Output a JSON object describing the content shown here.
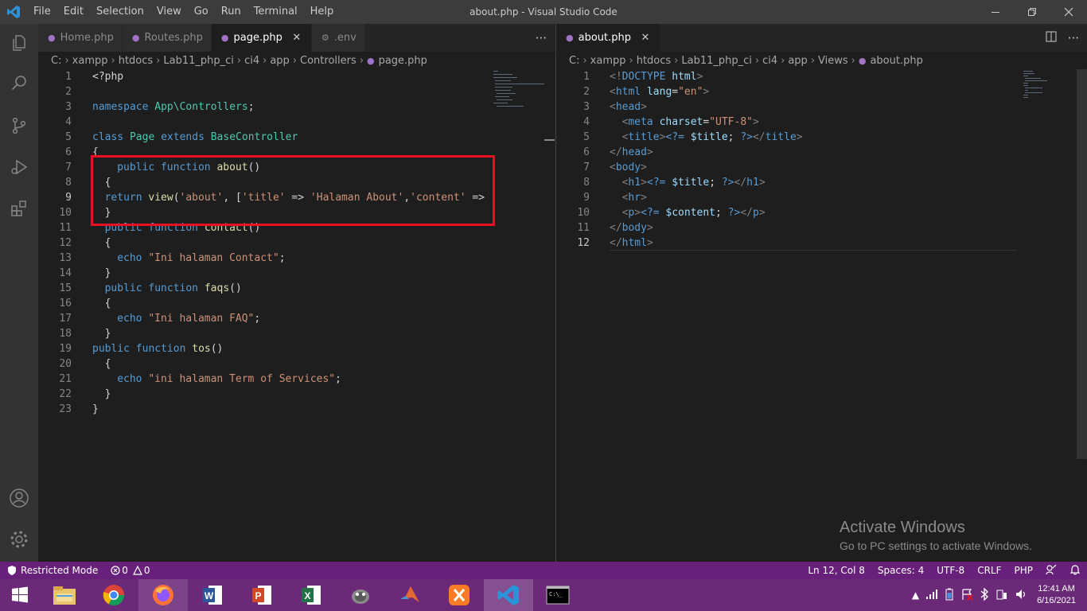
{
  "window": {
    "title": "about.php - Visual Studio Code",
    "menu": [
      "File",
      "Edit",
      "Selection",
      "View",
      "Go",
      "Run",
      "Terminal",
      "Help"
    ]
  },
  "left_editor": {
    "tabs": [
      {
        "label": "Home.php",
        "active": false
      },
      {
        "label": "Routes.php",
        "active": false
      },
      {
        "label": "page.php",
        "active": true
      },
      {
        "label": ".env",
        "active": false
      }
    ],
    "more": "···",
    "breadcrumb": [
      "C:",
      "xampp",
      "htdocs",
      "Lab11_php_ci",
      "ci4",
      "app",
      "Controllers",
      "page.php"
    ],
    "lines": [
      {
        "n": "1",
        "indent": 0,
        "parts": [
          [
            "pl",
            "<?php"
          ]
        ]
      },
      {
        "n": "2",
        "indent": 0,
        "parts": []
      },
      {
        "n": "3",
        "indent": 0,
        "parts": [
          [
            "kw",
            "namespace"
          ],
          [
            "pl",
            " "
          ],
          [
            "ns",
            "App\\Controllers"
          ],
          [
            "pl",
            ";"
          ]
        ]
      },
      {
        "n": "4",
        "indent": 0,
        "parts": []
      },
      {
        "n": "5",
        "indent": 0,
        "parts": [
          [
            "kw",
            "class"
          ],
          [
            "pl",
            " "
          ],
          [
            "ns",
            "Page"
          ],
          [
            "pl",
            " "
          ],
          [
            "kw",
            "extends"
          ],
          [
            "pl",
            " "
          ],
          [
            "ns",
            "BaseController"
          ]
        ]
      },
      {
        "n": "6",
        "indent": 0,
        "parts": [
          [
            "pl",
            "{"
          ]
        ]
      },
      {
        "n": "7",
        "indent": 2,
        "parts": [
          [
            "kw",
            "public"
          ],
          [
            "pl",
            " "
          ],
          [
            "kw",
            "function"
          ],
          [
            "pl",
            " "
          ],
          [
            "fn",
            "about"
          ],
          [
            "pl",
            "()"
          ]
        ]
      },
      {
        "n": "8",
        "indent": 1,
        "parts": [
          [
            "pl",
            "{"
          ]
        ]
      },
      {
        "n": "9",
        "indent": 1,
        "parts": [
          [
            "kw",
            "return"
          ],
          [
            "pl",
            " "
          ],
          [
            "fn",
            "view"
          ],
          [
            "pl",
            "("
          ],
          [
            "str",
            "'about'"
          ],
          [
            "pl",
            ", ["
          ],
          [
            "str",
            "'title'"
          ],
          [
            "pl",
            " => "
          ],
          [
            "str",
            "'Halaman About'"
          ],
          [
            "pl",
            ","
          ],
          [
            "str",
            "'content'"
          ],
          [
            "pl",
            " =>"
          ]
        ]
      },
      {
        "n": "10",
        "indent": 1,
        "parts": [
          [
            "pl",
            "}"
          ]
        ]
      },
      {
        "n": "11",
        "indent": 1,
        "parts": [
          [
            "kw",
            "public"
          ],
          [
            "pl",
            " "
          ],
          [
            "kw",
            "function"
          ],
          [
            "pl",
            " "
          ],
          [
            "fn",
            "contact"
          ],
          [
            "pl",
            "()"
          ]
        ]
      },
      {
        "n": "12",
        "indent": 1,
        "parts": [
          [
            "pl",
            "{"
          ]
        ]
      },
      {
        "n": "13",
        "indent": 2,
        "parts": [
          [
            "kw",
            "echo"
          ],
          [
            "pl",
            " "
          ],
          [
            "str",
            "\"Ini halaman Contact\""
          ],
          [
            "pl",
            ";"
          ]
        ]
      },
      {
        "n": "14",
        "indent": 1,
        "parts": [
          [
            "pl",
            "}"
          ]
        ]
      },
      {
        "n": "15",
        "indent": 1,
        "parts": [
          [
            "kw",
            "public"
          ],
          [
            "pl",
            " "
          ],
          [
            "kw",
            "function"
          ],
          [
            "pl",
            " "
          ],
          [
            "fn",
            "faqs"
          ],
          [
            "pl",
            "()"
          ]
        ]
      },
      {
        "n": "16",
        "indent": 1,
        "parts": [
          [
            "pl",
            "{"
          ]
        ]
      },
      {
        "n": "17",
        "indent": 2,
        "parts": [
          [
            "kw",
            "echo"
          ],
          [
            "pl",
            " "
          ],
          [
            "str",
            "\"Ini halaman FAQ\""
          ],
          [
            "pl",
            ";"
          ]
        ]
      },
      {
        "n": "18",
        "indent": 1,
        "parts": [
          [
            "pl",
            "}"
          ]
        ]
      },
      {
        "n": "19",
        "indent": 0,
        "parts": [
          [
            "kw",
            "public"
          ],
          [
            "pl",
            " "
          ],
          [
            "kw",
            "function"
          ],
          [
            "pl",
            " "
          ],
          [
            "fn",
            "tos"
          ],
          [
            "pl",
            "()"
          ]
        ]
      },
      {
        "n": "20",
        "indent": 1,
        "parts": [
          [
            "pl",
            "{"
          ]
        ]
      },
      {
        "n": "21",
        "indent": 2,
        "parts": [
          [
            "kw",
            "echo"
          ],
          [
            "pl",
            " "
          ],
          [
            "str",
            "\"ini halaman Term of Services\""
          ],
          [
            "pl",
            ";"
          ]
        ]
      },
      {
        "n": "22",
        "indent": 1,
        "parts": [
          [
            "pl",
            "}"
          ]
        ]
      },
      {
        "n": "23",
        "indent": 0,
        "parts": [
          [
            "pl",
            "}"
          ]
        ]
      }
    ]
  },
  "right_editor": {
    "tabs": [
      {
        "label": "about.php",
        "active": true
      }
    ],
    "breadcrumb": [
      "C:",
      "xampp",
      "htdocs",
      "Lab11_php_ci",
      "ci4",
      "app",
      "Views",
      "about.php"
    ],
    "lines": [
      {
        "n": "1",
        "indent": 0,
        "parts": [
          [
            "gt",
            "<!"
          ],
          [
            "tag",
            "DOCTYPE"
          ],
          [
            "pl",
            " "
          ],
          [
            "attr",
            "html"
          ],
          [
            "gt",
            ">"
          ]
        ]
      },
      {
        "n": "2",
        "indent": 0,
        "parts": [
          [
            "gt",
            "<"
          ],
          [
            "tag",
            "html"
          ],
          [
            "pl",
            " "
          ],
          [
            "attr",
            "lang"
          ],
          [
            "pl",
            "="
          ],
          [
            "str",
            "\"en\""
          ],
          [
            "gt",
            ">"
          ]
        ]
      },
      {
        "n": "3",
        "indent": 0,
        "parts": [
          [
            "gt",
            "<"
          ],
          [
            "tag",
            "head"
          ],
          [
            "gt",
            ">"
          ]
        ]
      },
      {
        "n": "4",
        "indent": 1,
        "parts": [
          [
            "gt",
            "<"
          ],
          [
            "tag",
            "meta"
          ],
          [
            "pl",
            " "
          ],
          [
            "attr",
            "charset"
          ],
          [
            "pl",
            "="
          ],
          [
            "str",
            "\"UTF-8\""
          ],
          [
            "gt",
            ">"
          ]
        ]
      },
      {
        "n": "5",
        "indent": 1,
        "parts": [
          [
            "gt",
            "<"
          ],
          [
            "tag",
            "title"
          ],
          [
            "gt",
            ">"
          ],
          [
            "kw",
            "<?="
          ],
          [
            "pl",
            " "
          ],
          [
            "var",
            "$title"
          ],
          [
            "pl",
            "; "
          ],
          [
            "kw",
            "?>"
          ],
          [
            "gt",
            "</"
          ],
          [
            "tag",
            "title"
          ],
          [
            "gt",
            ">"
          ]
        ]
      },
      {
        "n": "6",
        "indent": 0,
        "parts": [
          [
            "gt",
            "</"
          ],
          [
            "tag",
            "head"
          ],
          [
            "gt",
            ">"
          ]
        ]
      },
      {
        "n": "7",
        "indent": 0,
        "parts": [
          [
            "gt",
            "<"
          ],
          [
            "tag",
            "body"
          ],
          [
            "gt",
            ">"
          ]
        ]
      },
      {
        "n": "8",
        "indent": 1,
        "parts": [
          [
            "gt",
            "<"
          ],
          [
            "tag",
            "h1"
          ],
          [
            "gt",
            ">"
          ],
          [
            "kw",
            "<?="
          ],
          [
            "pl",
            " "
          ],
          [
            "var",
            "$title"
          ],
          [
            "pl",
            "; "
          ],
          [
            "kw",
            "?>"
          ],
          [
            "gt",
            "</"
          ],
          [
            "tag",
            "h1"
          ],
          [
            "gt",
            ">"
          ]
        ]
      },
      {
        "n": "9",
        "indent": 1,
        "parts": [
          [
            "gt",
            "<"
          ],
          [
            "tag",
            "hr"
          ],
          [
            "gt",
            ">"
          ]
        ]
      },
      {
        "n": "10",
        "indent": 1,
        "parts": [
          [
            "gt",
            "<"
          ],
          [
            "tag",
            "p"
          ],
          [
            "gt",
            ">"
          ],
          [
            "kw",
            "<?="
          ],
          [
            "pl",
            " "
          ],
          [
            "var",
            "$content"
          ],
          [
            "pl",
            "; "
          ],
          [
            "kw",
            "?>"
          ],
          [
            "gt",
            "</"
          ],
          [
            "tag",
            "p"
          ],
          [
            "gt",
            ">"
          ]
        ]
      },
      {
        "n": "11",
        "indent": 0,
        "parts": [
          [
            "gt",
            "</"
          ],
          [
            "tag",
            "body"
          ],
          [
            "gt",
            ">"
          ]
        ]
      },
      {
        "n": "12",
        "indent": 0,
        "parts": [
          [
            "gt",
            "</"
          ],
          [
            "tag",
            "html"
          ],
          [
            "gt",
            ">"
          ]
        ]
      }
    ]
  },
  "statusbar": {
    "restricted": "Restricted Mode",
    "errors": "0",
    "warnings": "0",
    "position": "Ln 12, Col 8",
    "spaces": "Spaces: 4",
    "encoding": "UTF-8",
    "eol": "CRLF",
    "language": "PHP"
  },
  "watermark": {
    "line1": "Activate Windows",
    "line2": "Go to PC settings to activate Windows."
  },
  "taskbar": {
    "time": "12:41 AM",
    "date": "6/16/2021",
    "apps": [
      "start-icon",
      "file-explorer-icon",
      "chrome-icon",
      "firefox-icon",
      "word-icon",
      "powerpoint-icon",
      "excel-icon",
      "gimp-icon",
      "matlab-icon",
      "xampp-icon",
      "vscode-icon",
      "cmd-icon"
    ]
  },
  "colors": {
    "statusbar": "#68217a",
    "taskbar": "#6a2a78",
    "highlight_box": "#e81123"
  }
}
